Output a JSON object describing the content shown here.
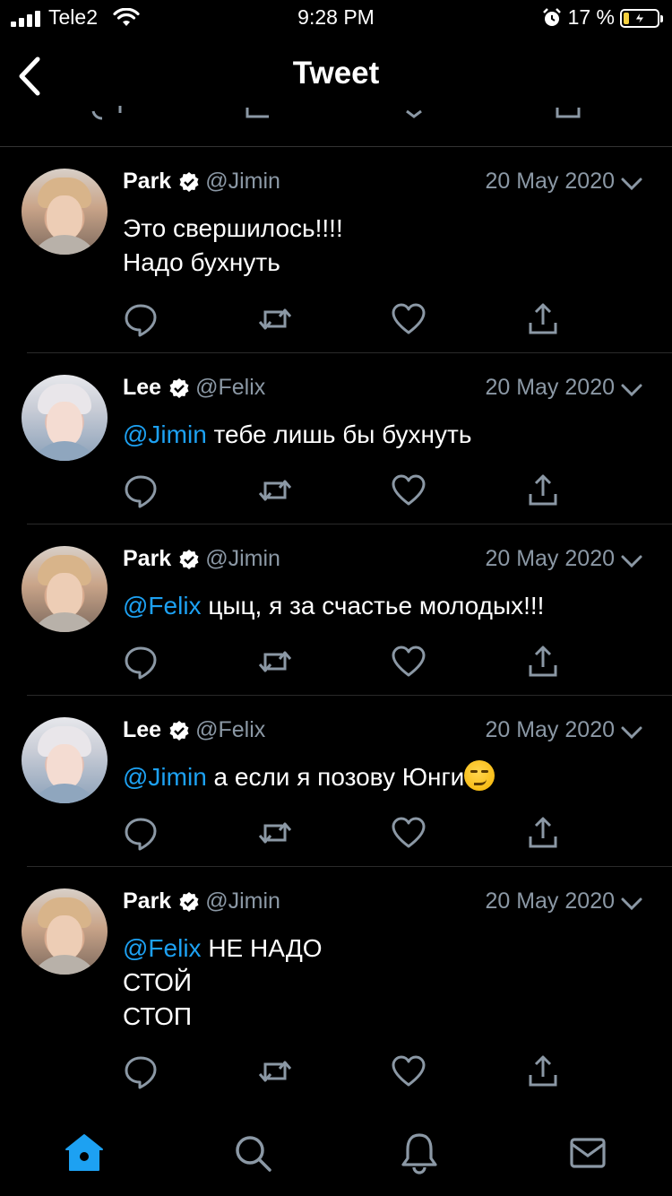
{
  "status_bar": {
    "carrier": "Tele2",
    "time": "9:28 PM",
    "battery_percent": "17 %",
    "battery_level": 0.17,
    "icons": [
      "signal-icon",
      "wifi-icon",
      "alarm-icon",
      "battery-charging-icon"
    ]
  },
  "nav": {
    "title": "Tweet",
    "back_icon": "chevron-left-icon"
  },
  "colors": {
    "background": "#000000",
    "text": "#ffffff",
    "secondary": "#8b98a5",
    "accent": "#1da1f2",
    "divider": "#2a2a2a"
  },
  "tweets": [
    {
      "name": "Park",
      "handle": "@Jimin",
      "date": "20 May 2020",
      "verified": true,
      "lines": [
        {
          "mention": "",
          "text": "Это свершилось!!!!"
        },
        {
          "mention": "",
          "text": "Надо бухнуть"
        }
      ]
    },
    {
      "name": "Lee",
      "handle": "@Felix",
      "date": "20 May 2020",
      "verified": true,
      "lines": [
        {
          "mention": "@Jimin",
          "text": " тебе лишь бы бухнуть"
        }
      ]
    },
    {
      "name": "Park",
      "handle": "@Jimin",
      "date": "20 May 2020",
      "verified": true,
      "lines": [
        {
          "mention": "@Felix",
          "text": " цыц, я за счастье молодых!!!"
        }
      ]
    },
    {
      "name": "Lee",
      "handle": "@Felix",
      "date": "20 May 2020",
      "verified": true,
      "lines": [
        {
          "mention": "@Jimin",
          "text": " а если я позову Юнги"
        }
      ],
      "emoji": "smirking-face-emoji"
    },
    {
      "name": "Park",
      "handle": "@Jimin",
      "date": "20 May 2020",
      "verified": true,
      "lines": [
        {
          "mention": "@Felix",
          "text": " НЕ НАДО"
        },
        {
          "mention": "",
          "text": "СТОЙ"
        },
        {
          "mention": "",
          "text": "СТОП"
        }
      ]
    }
  ],
  "tweet_actions": [
    "reply-icon",
    "retweet-icon",
    "like-icon",
    "share-icon"
  ],
  "tab_bar": {
    "items": [
      "home-icon",
      "search-icon",
      "notifications-icon",
      "messages-icon"
    ],
    "active": "home-icon"
  }
}
